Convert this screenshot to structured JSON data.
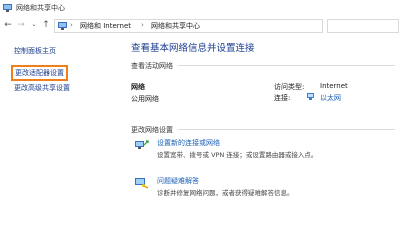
{
  "window": {
    "title": "网络和共享中心"
  },
  "address_bar": {
    "segments": [
      "网络和 Internet",
      "网络和共享中心"
    ],
    "separator": "›"
  },
  "sidebar": {
    "items": [
      {
        "label": "控制面板主页"
      },
      {
        "label": "更改适配器设置"
      },
      {
        "label": "更改高级共享设置"
      }
    ]
  },
  "main": {
    "title": "查看基本网络信息并设置连接",
    "active_networks": {
      "section_label": "查看活动网络",
      "network_name": "网络",
      "network_type": "公用网络",
      "access_type_label": "访问类型:",
      "access_type_value": "Internet",
      "connection_label": "连接:",
      "connection_value": "以太网"
    },
    "change_settings": {
      "section_label": "更改网络设置",
      "items": [
        {
          "title": "设置新的连接或网络",
          "description": "设置宽带、拨号或 VPN 连接；或设置路由器或接入点。"
        },
        {
          "title": "问题疑难解答",
          "description": "诊断并修复网络问题，或者获得疑难解答信息。"
        }
      ]
    }
  },
  "colors": {
    "highlight": "#f07f1a",
    "link": "#1a5fb4"
  },
  "icons": [
    "window-icon",
    "back-arrow-icon",
    "forward-arrow-icon",
    "dropdown-icon",
    "up-arrow-icon",
    "network-globe-icon",
    "ethernet-icon",
    "connection-setup-icon",
    "troubleshoot-icon"
  ]
}
